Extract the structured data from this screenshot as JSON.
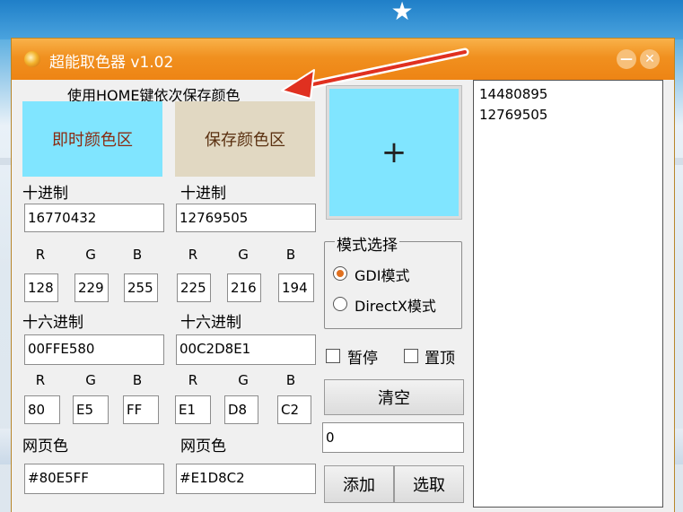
{
  "app": {
    "title": "超能取色器 v1.02"
  },
  "window_controls": {
    "minimize": "—",
    "close": "✕"
  },
  "hint": "使用HOME键依次保存颜色",
  "instant": {
    "swatch_label": "即时颜色区",
    "swatch_color": "#80E5FF",
    "decimal_label": "十进制",
    "decimal_value": "16770432",
    "rgb_labels": [
      "R",
      "G",
      "B"
    ],
    "rgb_values": [
      "128",
      "229",
      "255"
    ],
    "hex_label": "十六进制",
    "hex_value": "00FFE580",
    "hex_channel_labels": [
      "R",
      "G",
      "B"
    ],
    "hex_channels": [
      "80",
      "E5",
      "FF"
    ],
    "web_label": "网页色",
    "web_value": "#80E5FF"
  },
  "saved": {
    "swatch_label": "保存颜色区",
    "swatch_color": "#E1D8C2",
    "decimal_label": "十进制",
    "decimal_value": "12769505",
    "rgb_labels": [
      "R",
      "G",
      "B"
    ],
    "rgb_values": [
      "225",
      "216",
      "194"
    ],
    "hex_label": "十六进制",
    "hex_value": "00C2D8E1",
    "hex_channel_labels": [
      "R",
      "G",
      "B"
    ],
    "hex_channels": [
      "E1",
      "D8",
      "C2"
    ],
    "web_label": "网页色",
    "web_value": "#E1D8C2"
  },
  "preview": {
    "crosshair": "+"
  },
  "mode": {
    "title": "模式选择",
    "options": [
      {
        "label": "GDI模式",
        "selected": true
      },
      {
        "label": "DirectX模式",
        "selected": false
      }
    ]
  },
  "options": {
    "pause_label": "暂停",
    "topmost_label": "置顶"
  },
  "clear_button": "清空",
  "value_input": "0",
  "add_button": "添加",
  "pick_button": "选取",
  "saved_list": [
    "14480895",
    "12769505"
  ],
  "colors": {
    "titlebar": "#F0901F",
    "arrow": "#E03020"
  }
}
